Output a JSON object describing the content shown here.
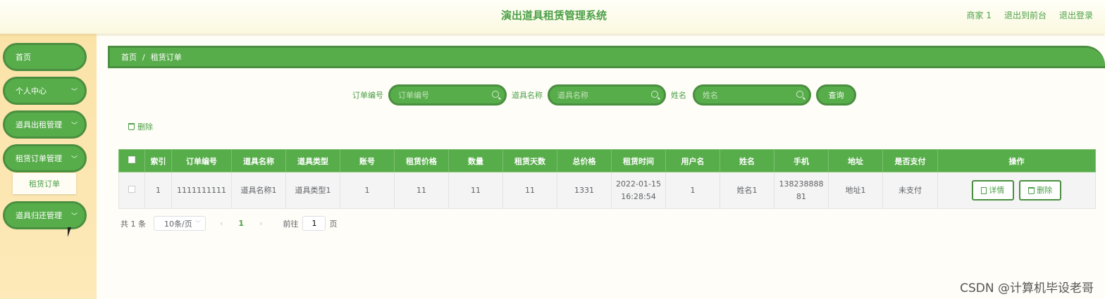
{
  "header": {
    "title": "演出道具租赁管理系统",
    "links": [
      "商家 1",
      "退出到前台",
      "退出登录"
    ]
  },
  "sidebar": {
    "items": [
      {
        "label": "首页",
        "has_arrow": false
      },
      {
        "label": "个人中心",
        "has_arrow": true
      },
      {
        "label": "道具出租管理",
        "has_arrow": true
      },
      {
        "label": "租赁订单管理",
        "has_arrow": true
      },
      {
        "label": "道具归还管理",
        "has_arrow": true
      }
    ],
    "submenu_label": "租赁订单"
  },
  "breadcrumb": {
    "home": "首页",
    "sep": "/",
    "current": "租赁订单"
  },
  "search": {
    "fields": [
      {
        "label": "订单编号",
        "placeholder": "订单编号"
      },
      {
        "label": "道具名称",
        "placeholder": "道具名称"
      },
      {
        "label": "姓名",
        "placeholder": "姓名"
      }
    ],
    "query_label": "查询"
  },
  "toolbar": {
    "delete_label": "删除"
  },
  "table": {
    "columns": [
      "索引",
      "订单编号",
      "道具名称",
      "道具类型",
      "账号",
      "租赁价格",
      "数量",
      "租赁天数",
      "总价格",
      "租赁时间",
      "用户名",
      "姓名",
      "手机",
      "地址",
      "是否支付",
      "操作"
    ],
    "rows": [
      {
        "index": "1",
        "order_no": "1111111111",
        "prop_name": "道具名称1",
        "prop_type": "道具类型1",
        "account": "1",
        "price": "11",
        "qty": "11",
        "days": "11",
        "total": "1331",
        "time_date": "2022-01-15",
        "time_clock": "16:28:54",
        "username": "1",
        "name": "姓名1",
        "phone_a": "138238888",
        "phone_b": "81",
        "address": "地址1",
        "paid": "未支付",
        "detail_label": "详情",
        "delete_label": "删除"
      }
    ]
  },
  "pagination": {
    "total": "共 1 条",
    "page_size": "10条/页",
    "prev": "‹",
    "current_page": "1",
    "next": "›",
    "goto_label": "前往",
    "goto_value": "1",
    "page_suffix": "页"
  },
  "watermark": "CSDN @计算机毕设老哥",
  "colors": {
    "primary": "#58ad4b",
    "primary_border": "#4a8f40",
    "sidebar_bg": "#fde9b9",
    "title": "#4ca048"
  },
  "icons": [
    "search-icon",
    "chevron-down-icon",
    "trash-icon",
    "document-icon",
    "mouse-cursor-icon"
  ]
}
